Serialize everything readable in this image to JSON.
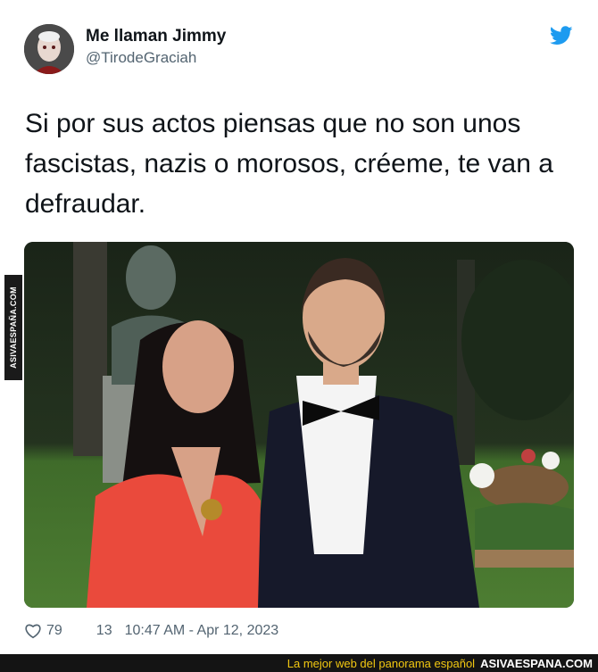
{
  "tweet": {
    "display_name": "Me llaman Jimmy",
    "handle": "@TirodeGraciah",
    "text": "Si por sus actos piensas que no son unos fascistas, nazis o morosos, créeme, te van a defraudar.",
    "likes": "79",
    "replies": "13",
    "timestamp": "10:47 AM - Apr 12, 2023"
  },
  "icons": {
    "brand": "twitter-bird-icon",
    "like": "heart-icon"
  },
  "colors": {
    "twitter_blue": "#1d9bf0",
    "text_primary": "#0f1419",
    "text_secondary": "#536471",
    "banner_bg": "#141414",
    "banner_accent": "#f2c811"
  },
  "watermark": {
    "side_label": "ASIVAESPAÑA.COM",
    "tagline": "La mejor web del panorama español",
    "brand": "ASIVAESPANA.COM"
  }
}
